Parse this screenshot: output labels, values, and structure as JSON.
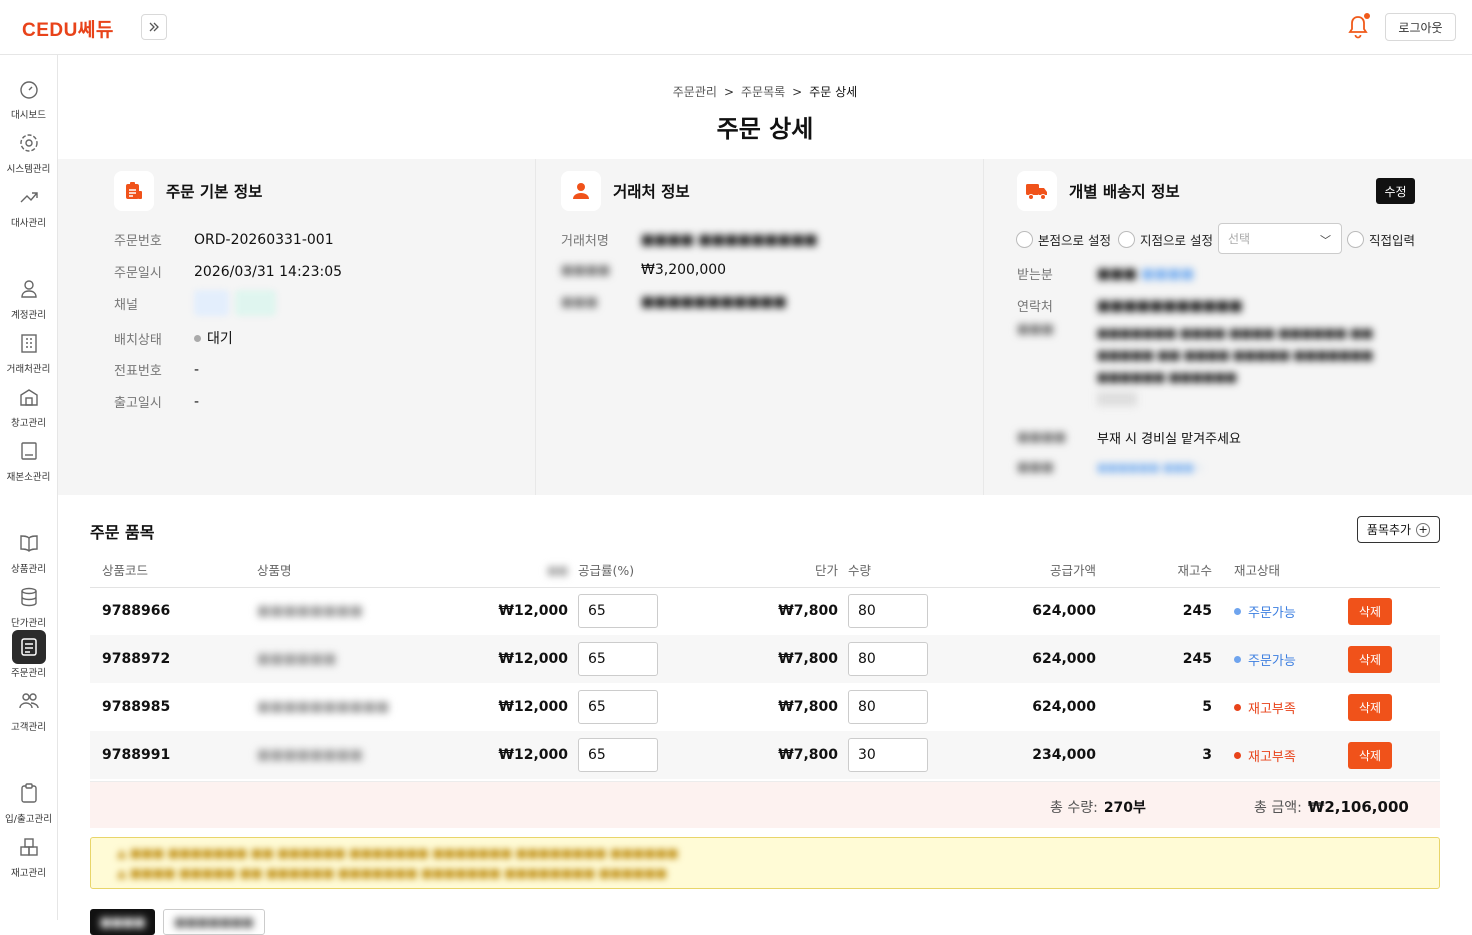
{
  "topbar": {
    "logo": "CEDU쎄듀",
    "logout_label": "로그아웃"
  },
  "sidebar": {
    "items": [
      {
        "label": "대시보드",
        "icon": "dashboard-icon"
      },
      {
        "label": "시스템관리",
        "icon": "gear-icon"
      },
      {
        "label": "대사관리",
        "icon": "trend-icon"
      },
      {
        "label": "계정관리",
        "icon": "user-icon"
      },
      {
        "label": "거래처관리",
        "icon": "building-icon"
      },
      {
        "label": "창고관리",
        "icon": "warehouse-icon"
      },
      {
        "label": "재본소관리",
        "icon": "book-icon"
      },
      {
        "label": "상품관리",
        "icon": "open-book-icon"
      },
      {
        "label": "단가관리",
        "icon": "database-icon"
      },
      {
        "label": "주문관리",
        "icon": "order-icon",
        "active": true
      },
      {
        "label": "고객관리",
        "icon": "users-icon"
      },
      {
        "label": "입/출고관리",
        "icon": "clipboard-icon"
      },
      {
        "label": "재고관리",
        "icon": "boxes-icon"
      }
    ]
  },
  "breadcrumb": {
    "items": [
      "주문관리",
      "주문목록",
      "주문 상세"
    ],
    "sep": ">"
  },
  "page_title": "주문 상세",
  "basic_info": {
    "title": "주문 기본 정보",
    "rows": [
      {
        "label": "주문번호",
        "value": "ORD-20260331-001"
      },
      {
        "label": "주문일시",
        "value": "2026/03/31 14:23:05"
      },
      {
        "label": "채널",
        "value": ""
      },
      {
        "label": "배치상태",
        "value": "대기"
      },
      {
        "label": "전표번호",
        "value": "-"
      },
      {
        "label": "출고일시",
        "value": "-"
      }
    ]
  },
  "client_info": {
    "title": "거래처 정보",
    "rows": [
      {
        "label": "거래처명",
        "value": ""
      },
      {
        "label": "",
        "value": "₩3,200,000"
      },
      {
        "label": "",
        "value": ""
      }
    ]
  },
  "shipping_info": {
    "title": "개별 배송지 정보",
    "edit_label": "수정",
    "radio_main": "본점으로 설정",
    "radio_branch": "지점으로 설정",
    "select_placeholder": "선택",
    "radio_direct": "직접입력",
    "receiver_label": "받는분",
    "contact_label": "연락처",
    "note_value": "부재 시 경비실 맡겨주세요"
  },
  "items_section": {
    "title": "주문 품목",
    "add_label": "품목추가",
    "columns": [
      "상품코드",
      "상품명",
      "",
      "공급률(%)",
      "단가",
      "수량",
      "공급가액",
      "재고수",
      "재고상태",
      ""
    ],
    "rows": [
      {
        "code": "9788966",
        "price": "₩12,000",
        "rate": "65",
        "unit": "₩7,800",
        "qty": "80",
        "amount": "624,000",
        "stock": "245",
        "status": "주문가능",
        "status_type": "ok",
        "delete": "삭제"
      },
      {
        "code": "9788972",
        "price": "₩12,000",
        "rate": "65",
        "unit": "₩7,800",
        "qty": "80",
        "amount": "624,000",
        "stock": "245",
        "status": "주문가능",
        "status_type": "ok",
        "delete": "삭제"
      },
      {
        "code": "9788985",
        "price": "₩12,000",
        "rate": "65",
        "unit": "₩7,800",
        "qty": "80",
        "amount": "624,000",
        "stock": "5",
        "status": "재고부족",
        "status_type": "low",
        "delete": "삭제"
      },
      {
        "code": "9788991",
        "price": "₩12,000",
        "rate": "65",
        "unit": "₩7,800",
        "qty": "30",
        "amount": "234,000",
        "stock": "3",
        "status": "재고부족",
        "status_type": "low",
        "delete": "삭제"
      }
    ],
    "total_qty_label": "총 수량:",
    "total_qty": "270부",
    "total_amount_label": "총 금액:",
    "total_amount": "₩2,106,000"
  },
  "colors": {
    "accent": "#f0521a",
    "ok": "#3d7fe0",
    "low": "#e8431a"
  }
}
